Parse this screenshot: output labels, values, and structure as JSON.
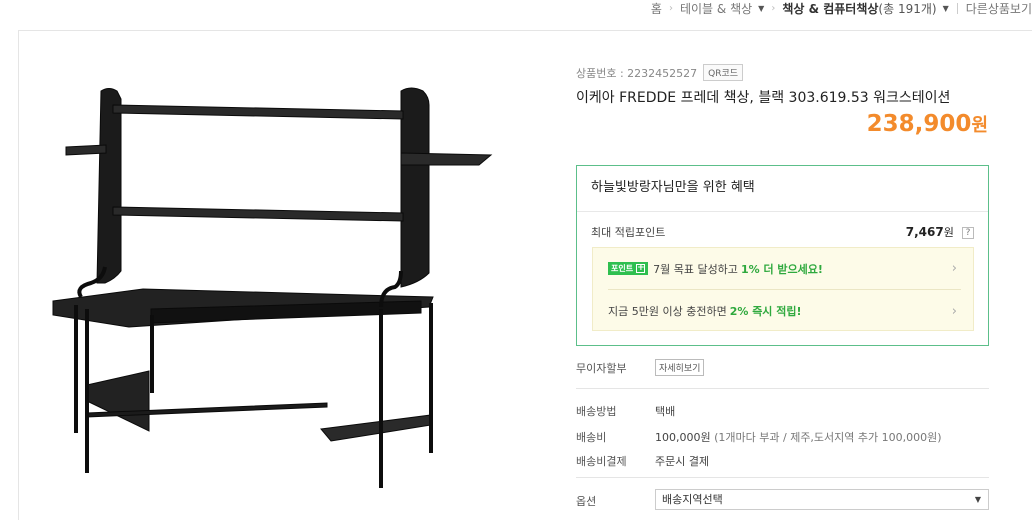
{
  "breadcrumb": {
    "home": "홈",
    "category": "테이블 & 책상",
    "current": "책상 & 컴퓨터책상",
    "count": "(총 191개)",
    "other": "다른상품보기"
  },
  "product": {
    "code_label": "상품번호 : 2232452527",
    "qr_label": "QR코드",
    "title": "이케아 FREDDE 프레데 책상, 블랙 303.619.53 워크스테이션",
    "price": "238,900",
    "price_unit": "원"
  },
  "benefit": {
    "header": "하늘빛방랑자님만을 위한 혜택",
    "points_label": "최대 적립포인트",
    "points_value": "7,467",
    "points_unit": "원",
    "help": "?",
    "promo1_badge": "포인트",
    "promo1_badge_plus": "+",
    "promo1_text": "7월 목표 달성하고",
    "promo1_highlight": "1% 더 받으세요!",
    "promo2_text": "지금 5만원 이상 충전하면",
    "promo2_highlight": "2% 즉시 적립!",
    "chevron": "›"
  },
  "installment": {
    "label": "무이자할부",
    "button": "자세히보기"
  },
  "shipping": {
    "method_label": "배송방법",
    "method_value": "택배",
    "fee_label": "배송비",
    "fee_value": "100,000원",
    "fee_note": "(1개마다 부과 / 제주,도서지역 추가 100,000원)",
    "payment_label": "배송비결제",
    "payment_value": "주문시 결제"
  },
  "option": {
    "label": "옵션",
    "selected": "배송지역선택"
  },
  "icons": {
    "breadcrumb_sep": "›",
    "caret": "▼"
  },
  "colors": {
    "price": "#f38b2c",
    "benefit_border": "#5cbf8a",
    "highlight_green": "#2fa93e",
    "promo_bg": "#fdfbe8"
  }
}
